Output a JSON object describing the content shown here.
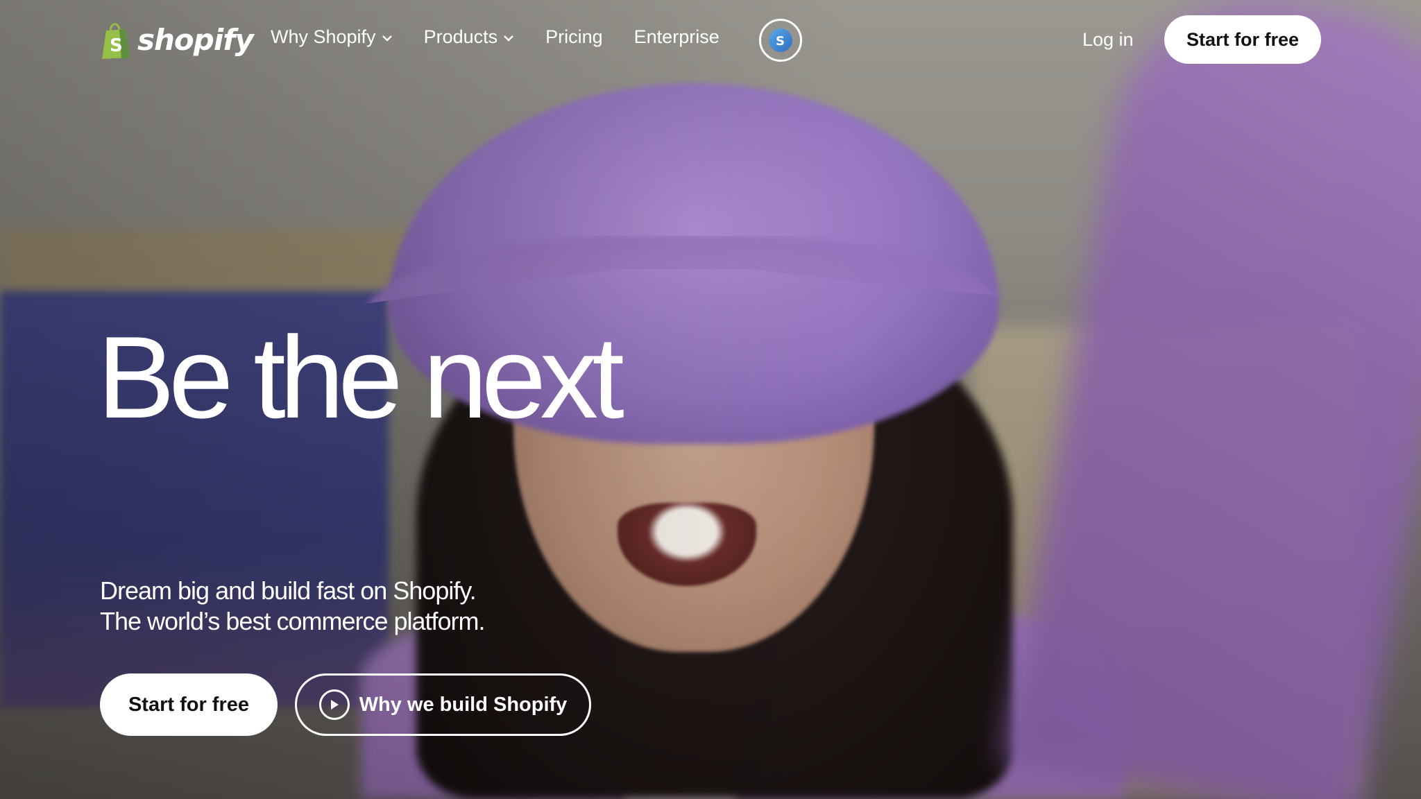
{
  "nav": {
    "logo_text": "shopify",
    "items": [
      {
        "label": "Why Shopify",
        "dropdown": true
      },
      {
        "label": "Products",
        "dropdown": true
      },
      {
        "label": "Pricing",
        "dropdown": false
      },
      {
        "label": "Enterprise",
        "dropdown": false
      }
    ],
    "shop_icon": "shop-app-icon",
    "login_label": "Log in",
    "start_label": "Start for free"
  },
  "hero": {
    "headline": "Be the next",
    "subtitle_line1": "Dream big and build fast on Shopify.",
    "subtitle_line2": "The world’s best commerce platform.",
    "cta_primary": "Start for free",
    "cta_secondary": "Why we build Shopify",
    "cta_secondary_icon": "play-icon"
  },
  "colors": {
    "brand_green": "#95bf47",
    "button_bg": "#ffffff",
    "button_text": "#111111",
    "text_on_image": "#ffffff"
  }
}
